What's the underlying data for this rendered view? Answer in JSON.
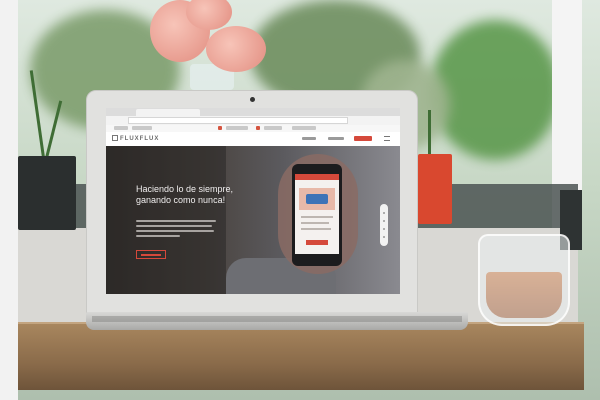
{
  "scene": {
    "description_colors": {
      "wall": "#d9d8d4",
      "desk": "#a8865e",
      "laptop": "#e1e1df",
      "tea": "#c2652a",
      "red_pot": "#d9482f",
      "accent": "#d5493b"
    }
  },
  "website": {
    "logo": "FLUXFLUX",
    "hero_title": "Haciendo lo de siempre, ganando como nunca!"
  },
  "icons": {
    "menu": "hamburger-menu-icon",
    "camera": "webcam-icon",
    "logo_mark": "square-logo-mark-icon"
  }
}
